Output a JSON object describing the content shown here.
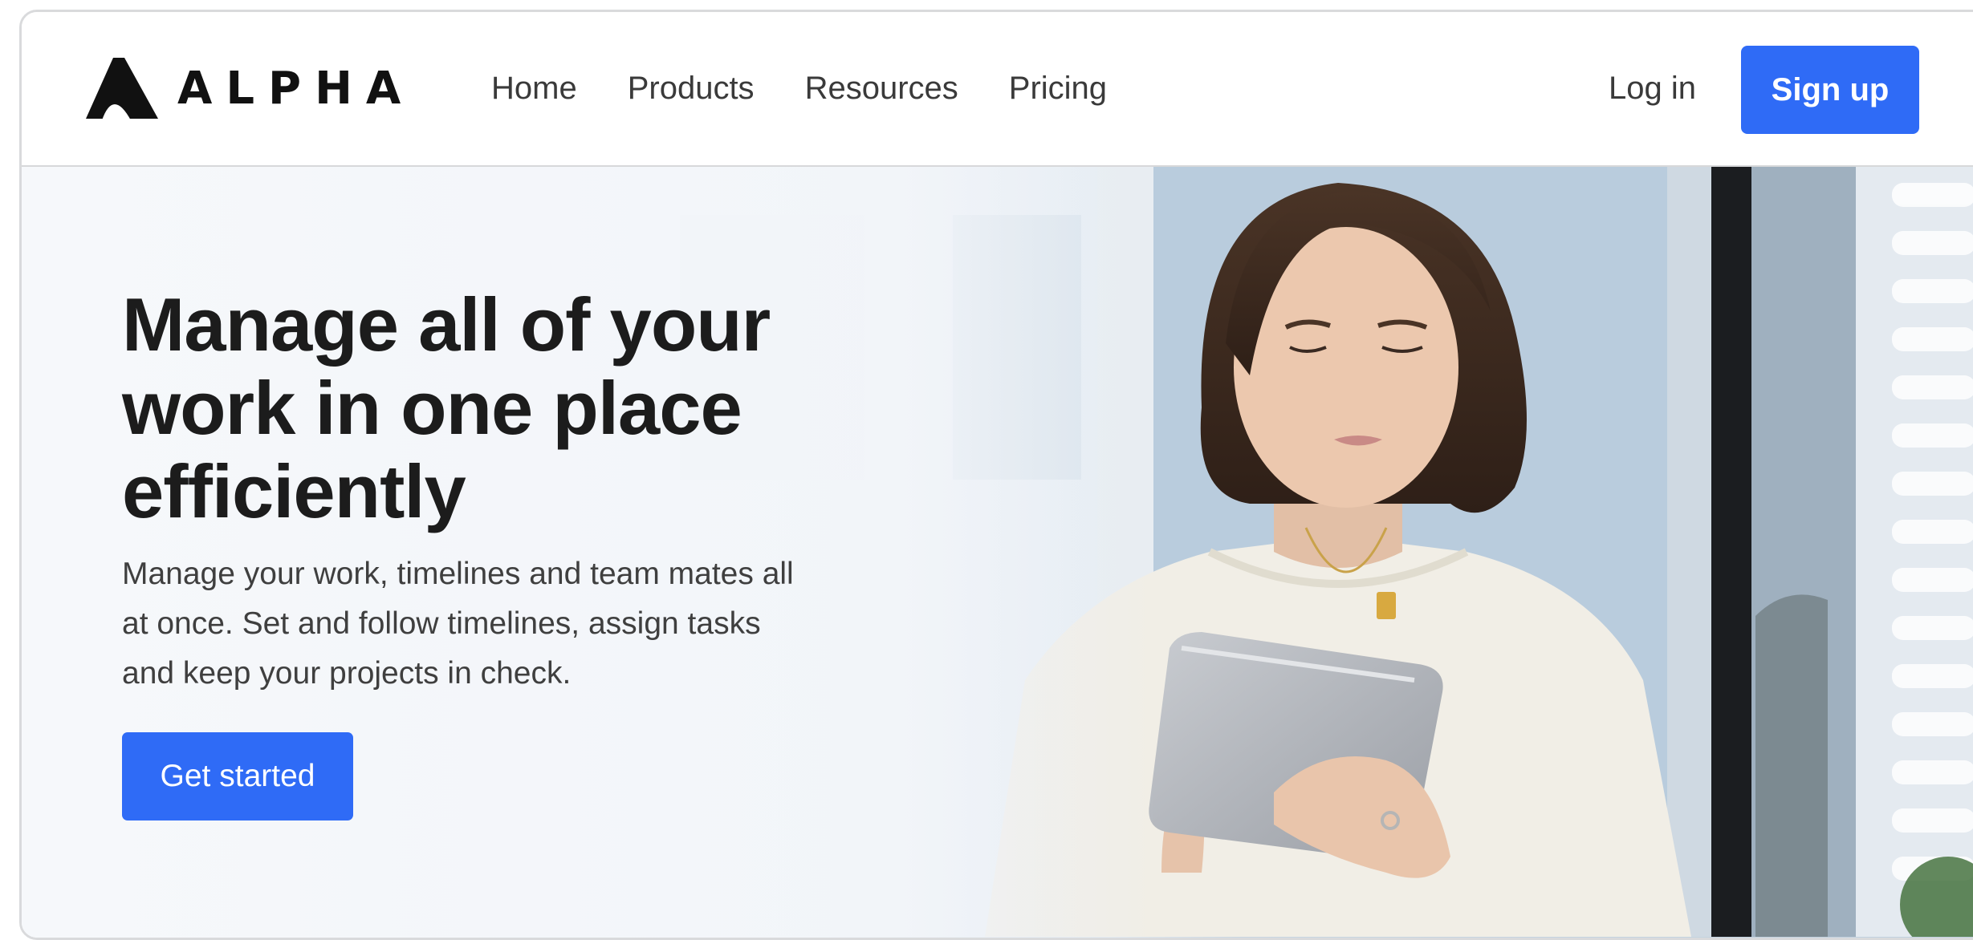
{
  "brand": {
    "name": "ALPHA",
    "logo_icon": "alpha-mountain-logo"
  },
  "nav": {
    "items": [
      {
        "label": "Home"
      },
      {
        "label": "Products"
      },
      {
        "label": "Resources"
      },
      {
        "label": "Pricing"
      }
    ]
  },
  "auth": {
    "login_label": "Log in",
    "signup_label": "Sign up"
  },
  "hero": {
    "title": "Manage all of your work in one place efficiently",
    "subtitle": "Manage your work, timelines and team mates all at once. Set and follow timelines, assign tasks and keep your projects in check.",
    "cta_label": "Get started"
  },
  "colors": {
    "accent": "#2f6bf6",
    "heading": "#1c1c1c",
    "body_text": "#3f3f3f",
    "nav_text": "#3a3a3a"
  }
}
